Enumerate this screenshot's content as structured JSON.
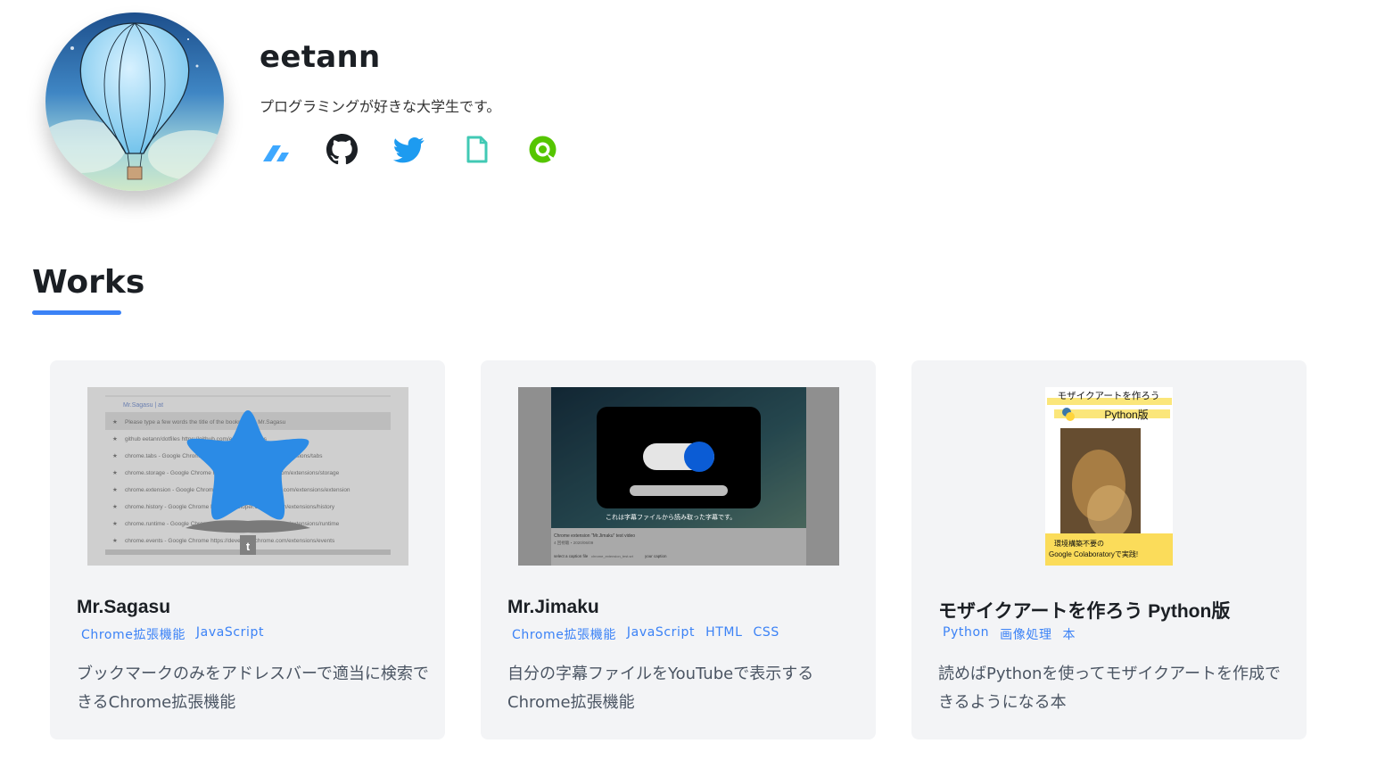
{
  "profile": {
    "name": "eetann",
    "bio": "プログラミングが好きな大学生です。",
    "social_icons": [
      "zenn-icon",
      "github-icon",
      "twitter-icon",
      "note-icon",
      "qiita-icon"
    ]
  },
  "works": {
    "title": "Works",
    "accent_color": "#3b82f6",
    "cards": [
      {
        "title": "Mr.Sagasu",
        "tags": [
          "Chrome拡張機能",
          "JavaScript"
        ],
        "description": "ブックマークのみをアドレスバーで適当に検索できるChrome拡張機能",
        "thumbnail": {
          "query_row": "Mr.Sagasu | at",
          "rows": [
            "Please type a few words the title of the bookmark. - Mr.Sagasu",
            "github eetann/dotfiles https://github.com/eetann/dotfiles",
            "chrome.tabs - Google Chrome https://developer.chrome.com/extensions/tabs",
            "chrome.storage - Google Chrome https://developer.chrome.com/extensions/storage",
            "chrome.extension - Google Chrome https://developer.chrome.com/extensions/extension",
            "chrome.history - Google Chrome https://developer.chrome.com/extensions/history",
            "chrome.runtime - Google Chrome https://developer.chrome.com/extensions/runtime",
            "chrome.events - Google Chrome https://developer.chrome.com/extensions/events"
          ],
          "badge": "t"
        }
      },
      {
        "title": "Mr.Jimaku",
        "tags": [
          "Chrome拡張機能",
          "JavaScript",
          "HTML",
          "CSS"
        ],
        "description": "自分の字幕ファイルをYouTubeで表示するChrome拡張機能",
        "thumbnail": {
          "caption": "これは字幕ファイルから読み取った字幕です。",
          "video_title": "Chrome extension \"Mr.Jimaku\" test video",
          "views": "4 回視聴・2020/06/09",
          "select_label": "select a caption file",
          "file_name": "chrome_extension_test.srt",
          "toggle_label": "your caption"
        }
      },
      {
        "title": "モザイクアートを作ろう Python版",
        "tags": [
          "Python",
          "画像処理",
          "本"
        ],
        "description": "読めばPythonを使ってモザイクアートを作成できるようになる本",
        "thumbnail": {
          "cover_title": "モザイクアートを作ろう",
          "cover_subtitle": "Python版",
          "cover_footer_1": "環境構築不要の",
          "cover_footer_2": "Google Colaboratoryで実践!"
        }
      }
    ]
  }
}
